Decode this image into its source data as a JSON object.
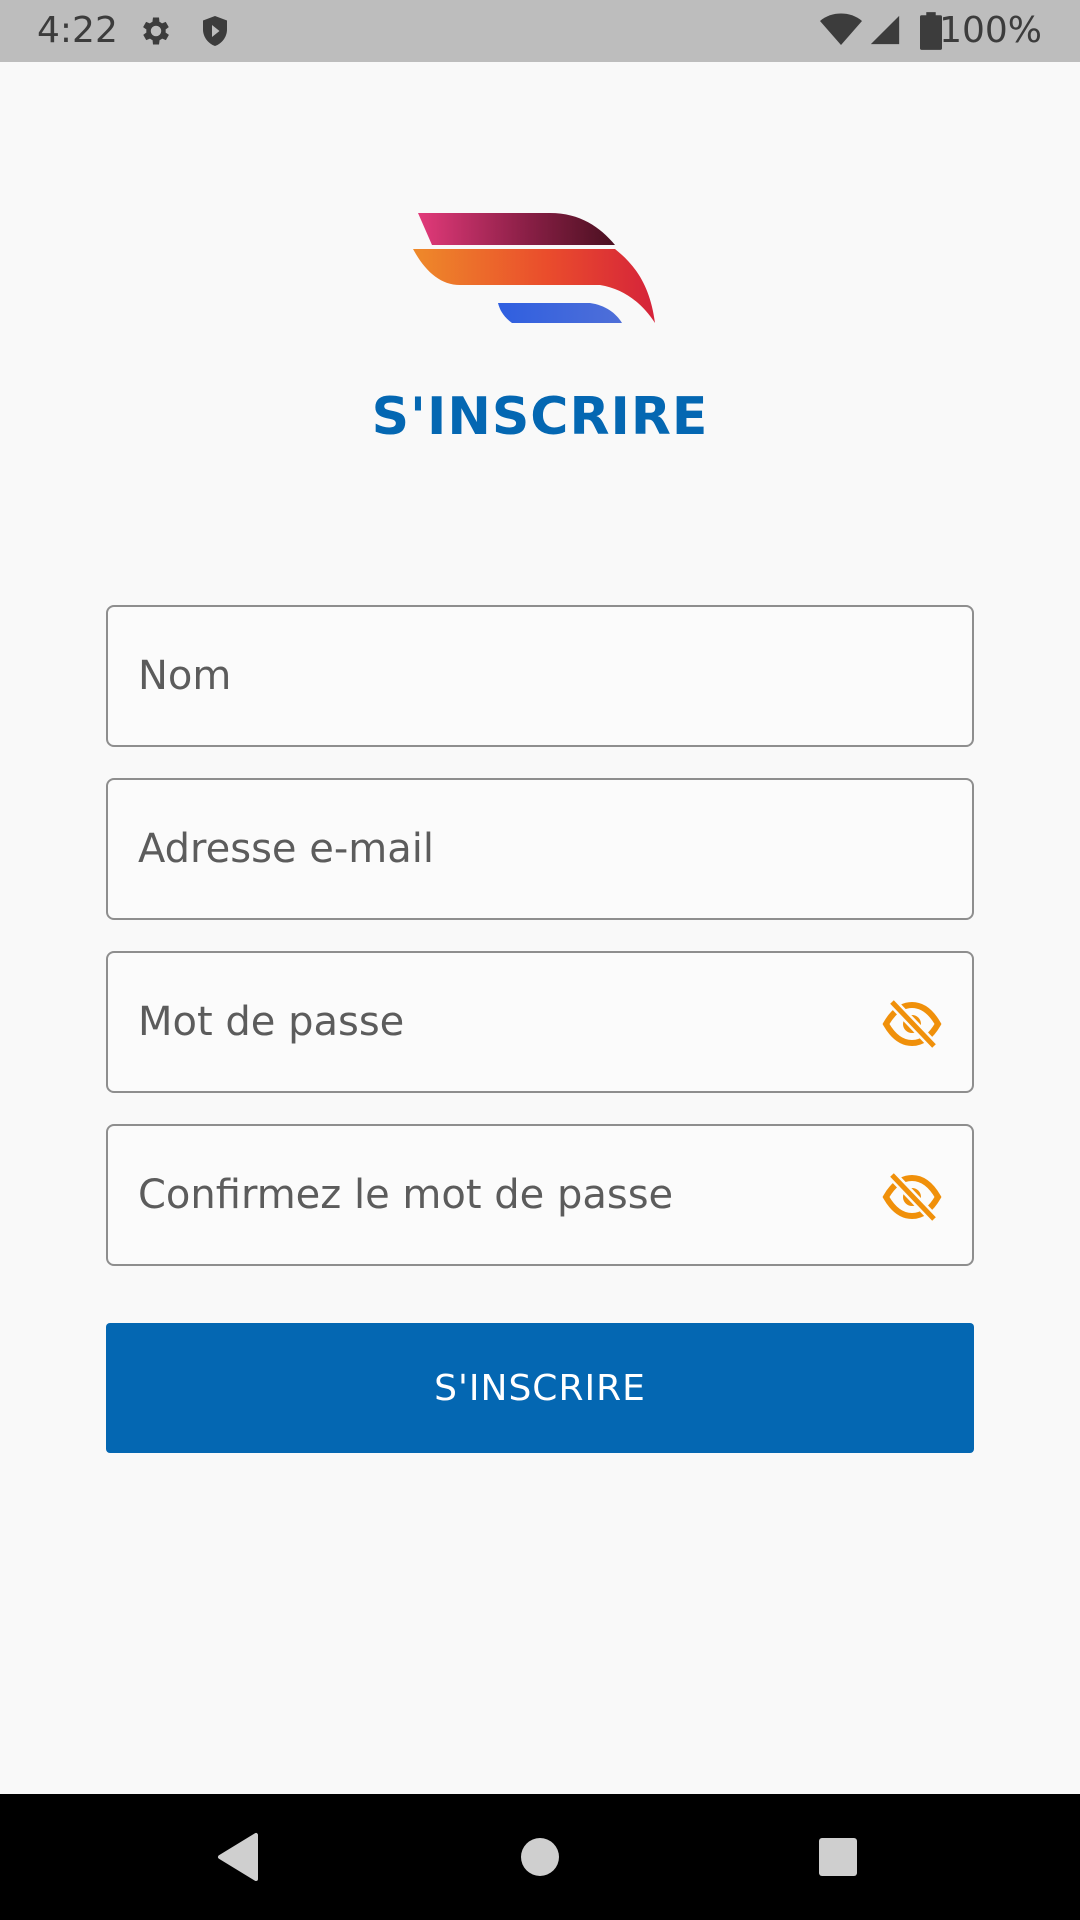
{
  "status_bar": {
    "time": "4:22",
    "battery": "100%",
    "icons": [
      "gear-icon",
      "shield-icon",
      "wifi-icon",
      "cell-signal-icon",
      "battery-icon"
    ]
  },
  "page": {
    "title": "S'INSCRIRE"
  },
  "form": {
    "name_placeholder": "Nom",
    "email_placeholder": "Adresse e-mail",
    "password_placeholder": "Mot de passe",
    "confirm_placeholder": "Confirmez le mot de passe",
    "submit_label": "S'INSCRIRE"
  },
  "colors": {
    "primary": "#0467b2",
    "eye_icon": "#f0900a",
    "status_bar": "#bdbdbd"
  },
  "nav_bar": {
    "icons": [
      "back-icon",
      "home-icon",
      "recents-icon"
    ]
  }
}
